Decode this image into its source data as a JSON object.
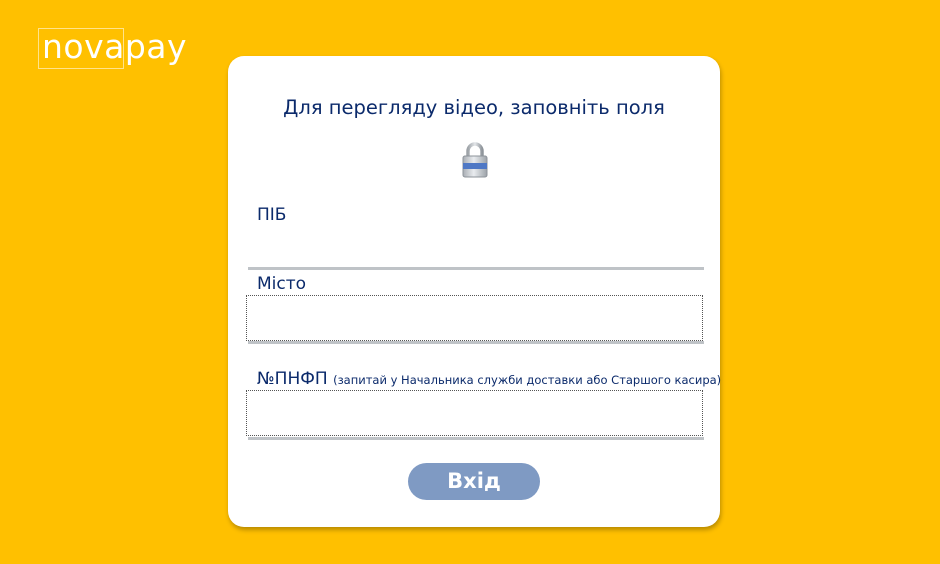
{
  "logo": {
    "text": "novapay"
  },
  "form": {
    "title": "Для перегляду відео, заповніть поля",
    "lock_icon": "lock-icon",
    "fields": [
      {
        "label": "ПІБ",
        "value": "",
        "placeholder": ""
      },
      {
        "label": "Місто",
        "value": "",
        "placeholder": ""
      },
      {
        "label": "№ПНФП",
        "hint": "(запитай у Начальника служби доставки або Старшого касира)",
        "value": "",
        "placeholder": ""
      }
    ],
    "submit_label": "Вхід"
  },
  "colors": {
    "background": "#FFC000",
    "card": "#FFFFFF",
    "text": "#0B2A6B",
    "button": "#7F9AC3"
  }
}
